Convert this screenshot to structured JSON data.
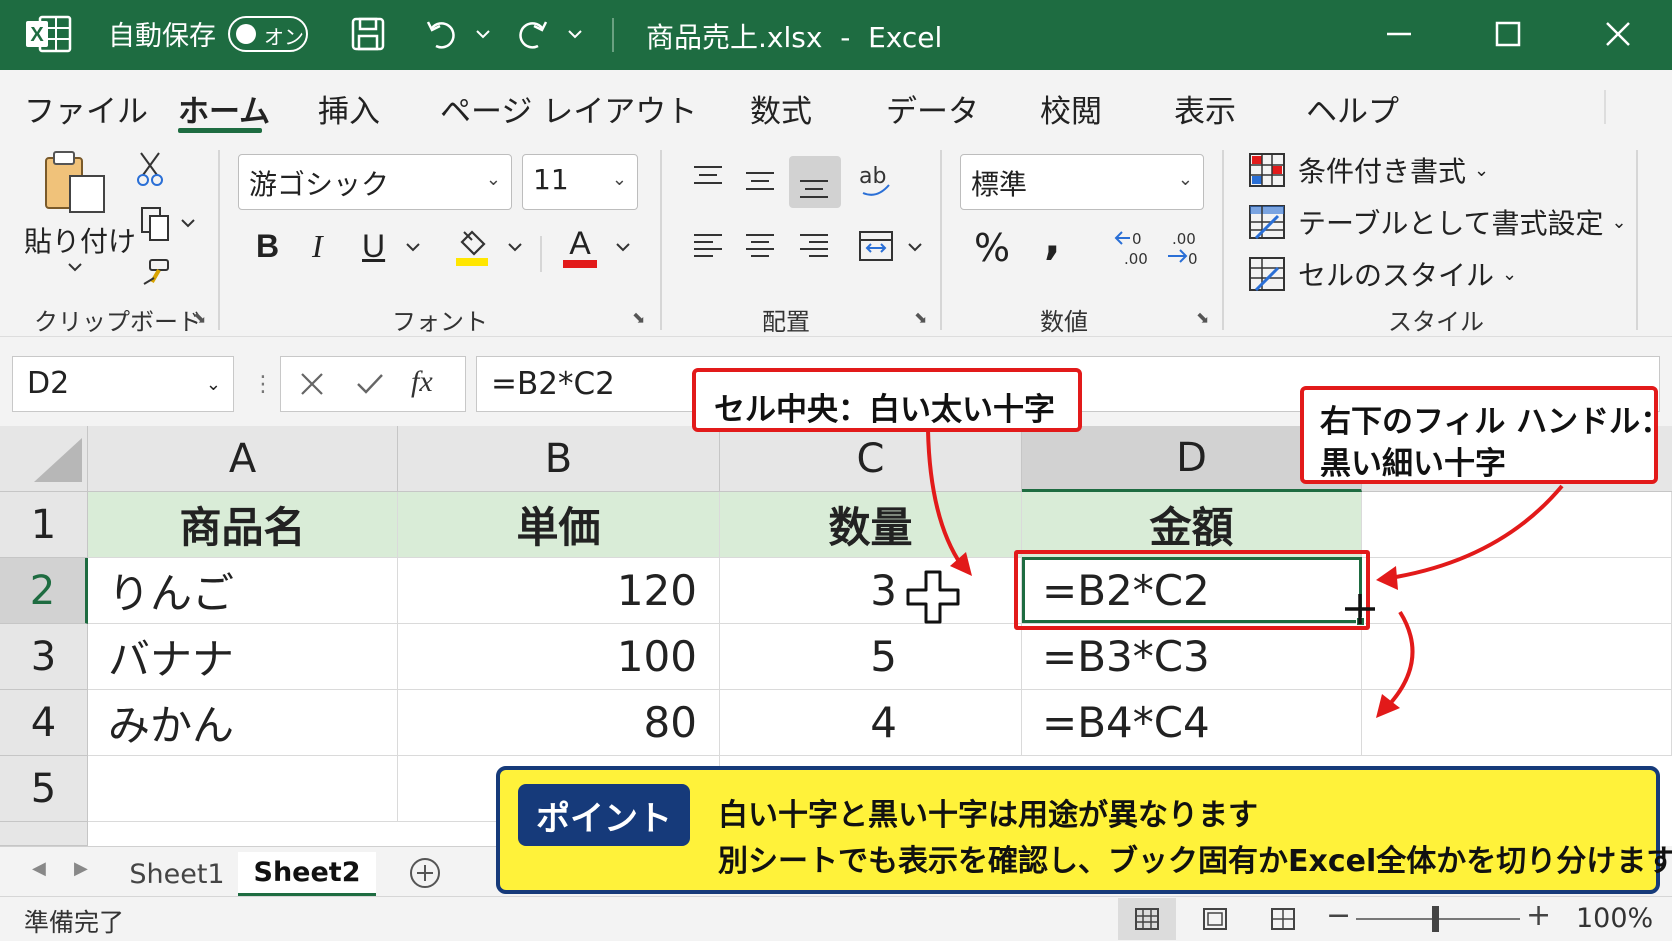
{
  "titlebar": {
    "autosave_label": "自動保存",
    "autosave_toggle": "オン",
    "doc_title": "商品売上.xlsx  -  Excel",
    "accent": "#1e6c41"
  },
  "menu": {
    "tabs": [
      "ファイル",
      "ホーム",
      "挿入",
      "ページ レイアウト",
      "数式",
      "データ",
      "校閲",
      "表示",
      "ヘルプ"
    ],
    "active": "ホーム"
  },
  "ribbon": {
    "clipboard": {
      "paste_label": "貼り付け",
      "group_label": "クリップボード"
    },
    "font": {
      "name": "游ゴシック",
      "size": "11",
      "bold": "B",
      "italic": "I",
      "underline": "U",
      "font_color_glyph": "A",
      "group_label": "フォント"
    },
    "alignment": {
      "group_label": "配置"
    },
    "number": {
      "format": "標準",
      "percent": "%",
      "comma": ",",
      "group_label": "数値"
    },
    "styles": {
      "conditional": "条件付き書式",
      "table": "テーブルとして書式設定",
      "cell_styles": "セルのスタイル",
      "group_label": "スタイル"
    }
  },
  "formula_bar": {
    "name_box": "D2",
    "formula": "=B2*C2",
    "fx": "fx"
  },
  "grid": {
    "columns": [
      "A",
      "B",
      "C",
      "D"
    ],
    "rows": [
      "1",
      "2",
      "3",
      "4",
      "5"
    ],
    "header_row": [
      "商品名",
      "単価",
      "数量",
      "金額"
    ],
    "data": [
      [
        "りんご",
        "120",
        "3",
        "=B2*C2"
      ],
      [
        "バナナ",
        "100",
        "5",
        "=B3*C3"
      ],
      [
        "みかん",
        "80",
        "4",
        "=B4*C4"
      ]
    ],
    "selected_cell": "D2",
    "header_fill": "#d9ecd7"
  },
  "callouts": {
    "center": "セル中央：白い太い十字",
    "fill_handle_line1": "右下のフィル ハンドル：",
    "fill_handle_line2": "黒い細い十字",
    "color": "#e21a1a"
  },
  "point": {
    "badge": "ポイント",
    "line1": "白い十字と黒い十字は用途が異なります",
    "line2": "別シートでも表示を確認し、ブック固有かExcel全体かを切り分けます",
    "fill": "#fff23a",
    "border": "#163a7a"
  },
  "sheets": {
    "tabs": [
      "Sheet1",
      "Sheet2"
    ],
    "active": "Sheet2"
  },
  "status": {
    "ready": "準備完了",
    "zoom": "100%"
  }
}
